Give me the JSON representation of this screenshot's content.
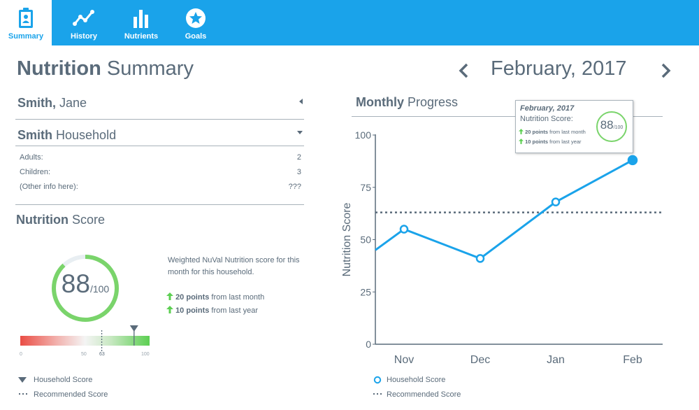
{
  "nav": {
    "tabs": [
      {
        "label": "Summary",
        "icon": "clipboard-icon",
        "active": true
      },
      {
        "label": "History",
        "icon": "line-chart-icon",
        "active": false
      },
      {
        "label": "Nutrients",
        "icon": "bar-chart-icon",
        "active": false
      },
      {
        "label": "Goals",
        "icon": "star-badge-icon",
        "active": false
      }
    ]
  },
  "page": {
    "title_bold": "Nutrition",
    "title_rest": " Summary",
    "current_month": "February, 2017",
    "prev_icon": "chevron-left-icon",
    "next_icon": "chevron-right-icon"
  },
  "person": {
    "last": "Smith,",
    "first": " Jane"
  },
  "household": {
    "bold": "Smith",
    "rest": " Household",
    "rows": [
      {
        "label": "Adults:",
        "value": "2"
      },
      {
        "label": "Children:",
        "value": "3"
      },
      {
        "label": "(Other info here):",
        "value": "???"
      }
    ]
  },
  "score": {
    "heading_bold": "Nutrition",
    "heading_rest": " Score",
    "value": "88",
    "out_of": "/100",
    "fraction": 0.88,
    "description": "Weighted NuVal Nutrition score for this month for this household.",
    "delta_month_bold": "20 points",
    "delta_month_rest": " from last month",
    "delta_year_bold": "10 points",
    "delta_year_rest": " from last year",
    "scale": {
      "min": "0",
      "mid": "50",
      "recommended": "63",
      "max": "100",
      "household_value": 88,
      "recommended_value": 63
    }
  },
  "legend_left": {
    "household": "Household Score",
    "recommended": "Recommended Score"
  },
  "progress": {
    "heading_bold": "Monthly",
    "heading_rest": " Progress"
  },
  "tooltip": {
    "date": "February, 2017",
    "label": "Nutrition Score:",
    "value": "88",
    "out_of": "/100",
    "delta_month_bold": "20 points",
    "delta_month_rest": " from last month",
    "delta_year_bold": "10 points",
    "delta_year_rest": " from last year"
  },
  "legend_right": {
    "household": "Household Score",
    "recommended": "Recommended Score"
  },
  "colors": {
    "brand": "#1aa3ea",
    "text": "#5a6b7a",
    "good": "#5ccf52",
    "bad": "#ea4d45",
    "axis": "#5a6b7a"
  },
  "chart_data": {
    "type": "line",
    "title": "Monthly Progress",
    "ylabel": "Nutrition Score",
    "xlabel": "",
    "categories": [
      "Nov",
      "Dec",
      "Jan",
      "Feb"
    ],
    "series": [
      {
        "name": "Household Score",
        "values": [
          55,
          41,
          68,
          88
        ],
        "leading_value": 45
      }
    ],
    "reference_line": {
      "name": "Recommended Score",
      "value": 63
    },
    "yticks": [
      0,
      25,
      50,
      75,
      100
    ],
    "ylim": [
      0,
      100
    ],
    "grid": false,
    "legend": "bottom-left"
  }
}
